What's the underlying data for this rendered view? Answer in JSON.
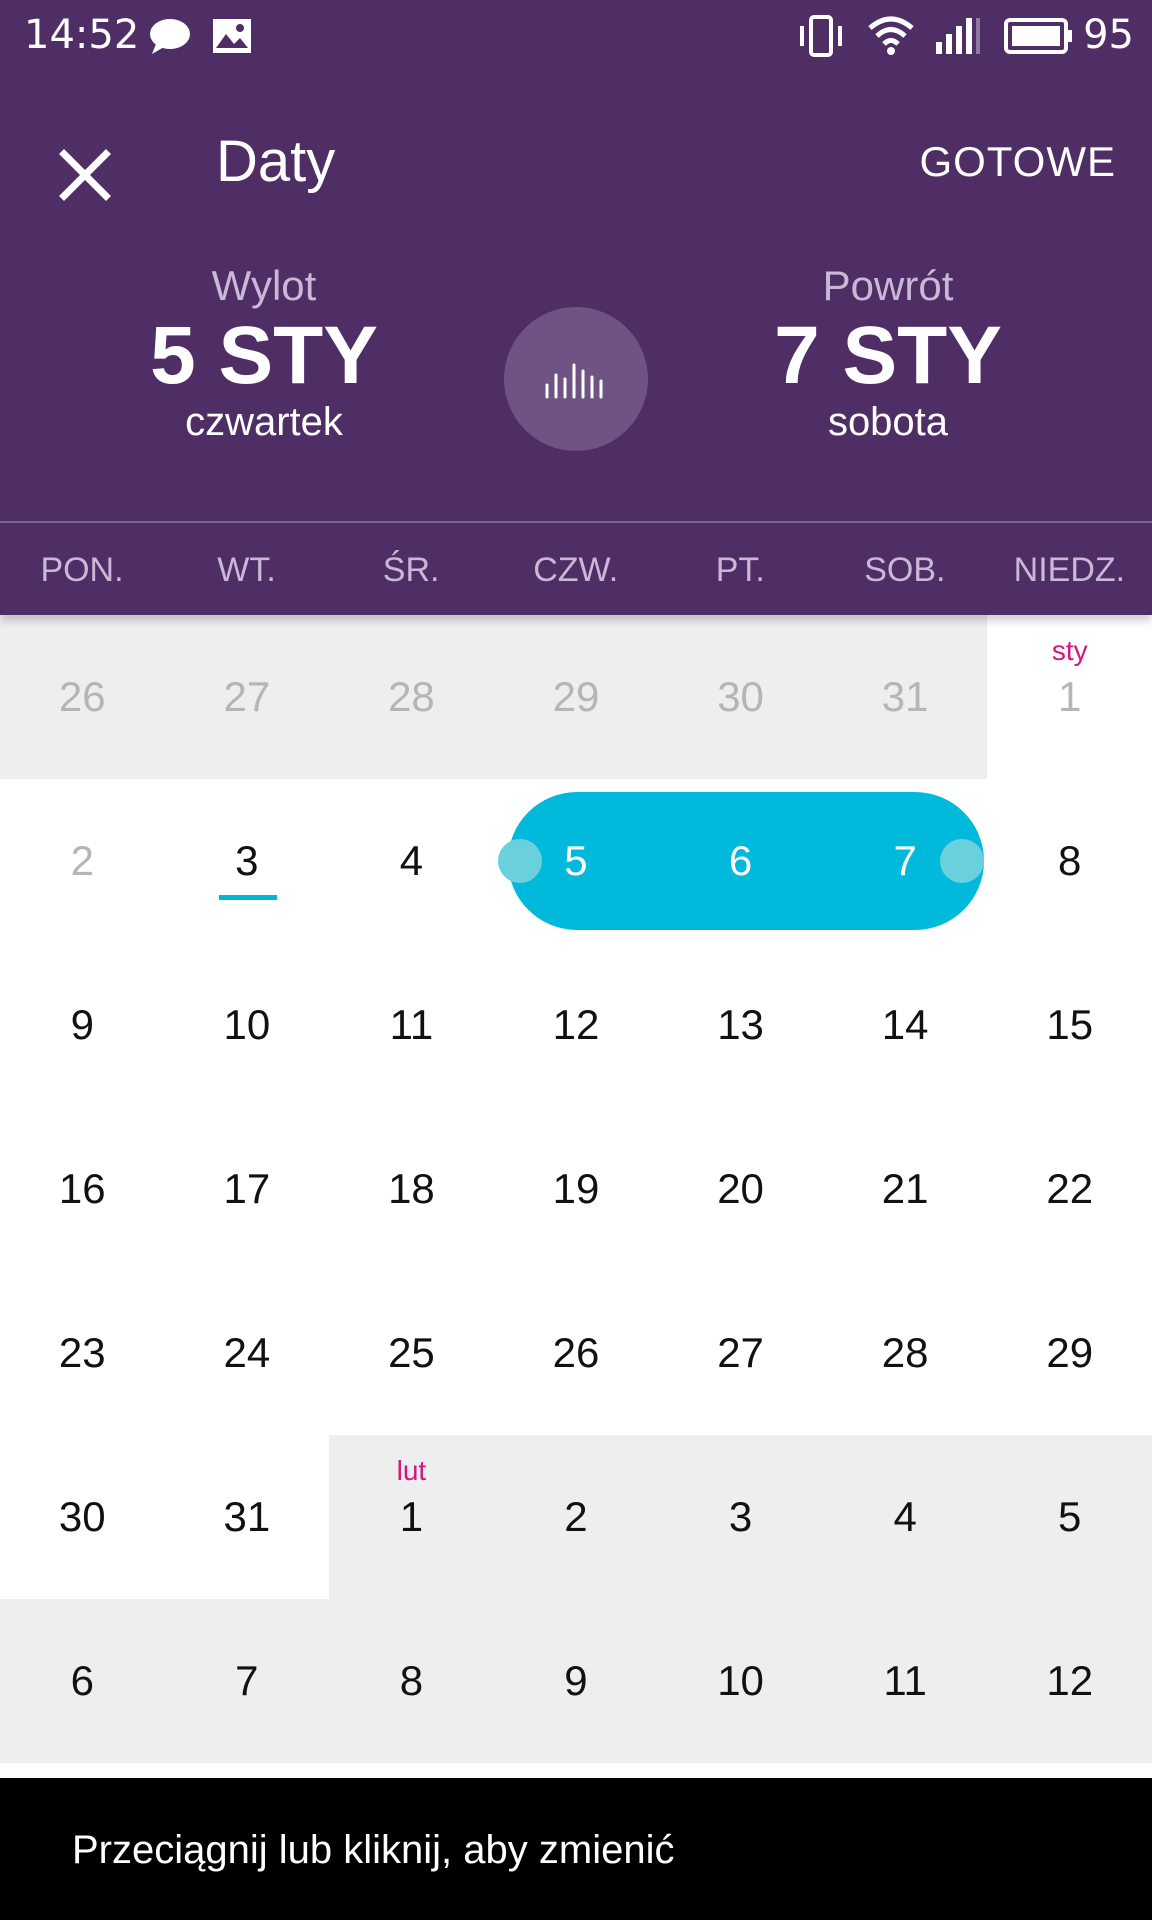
{
  "status_bar": {
    "time": "14:52",
    "battery": "95",
    "icons": [
      "chat-icon",
      "image-icon",
      "vibrate-icon",
      "wifi-icon",
      "signal-icon",
      "battery-icon"
    ]
  },
  "toolbar": {
    "title": "Daty",
    "done_label": "GOTOWE",
    "close_icon": "close-icon"
  },
  "departure": {
    "label": "Wylot",
    "date": "5 STY",
    "weekday": "czwartek"
  },
  "return": {
    "label": "Powrót",
    "date": "7 STY",
    "weekday": "sobota"
  },
  "price_chart_icon": "bar-chart-icon",
  "weekdays": [
    "PON.",
    "WT.",
    "ŚR.",
    "CZW.",
    "PT.",
    "SOB.",
    "NIEDZ."
  ],
  "calendar": {
    "weeks": [
      [
        "26",
        "27",
        "28",
        "29",
        "30",
        "31",
        "1"
      ],
      [
        "2",
        "3",
        "4",
        "5",
        "6",
        "7",
        "8"
      ],
      [
        "9",
        "10",
        "11",
        "12",
        "13",
        "14",
        "15"
      ],
      [
        "16",
        "17",
        "18",
        "19",
        "20",
        "21",
        "22"
      ],
      [
        "23",
        "24",
        "25",
        "26",
        "27",
        "28",
        "29"
      ],
      [
        "30",
        "31",
        "1",
        "2",
        "3",
        "4",
        "5"
      ],
      [
        "6",
        "7",
        "8",
        "9",
        "10",
        "11",
        "12"
      ]
    ],
    "month_labels": {
      "jan": "sty",
      "feb": "lut"
    },
    "today": "3",
    "selected_range": [
      "5",
      "7"
    ]
  },
  "colors": {
    "header": "#4f2e66",
    "accent": "#00b9db",
    "month_label": "#d3177f",
    "grey_cell": "#eeeeee"
  },
  "toast": {
    "text": "Przeciągnij lub kliknij, aby zmienić"
  }
}
